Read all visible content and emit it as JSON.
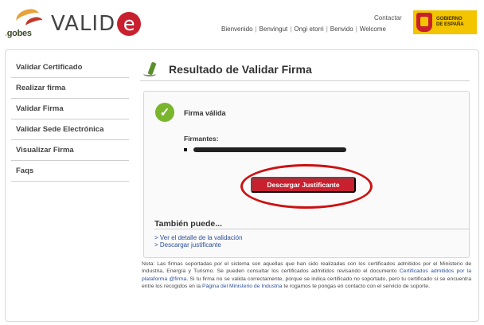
{
  "header": {
    "gob_logo_text": "gob",
    "gob_logo_suffix": "es",
    "app_logo_text": "VALID",
    "app_logo_letter": "e",
    "contact_label": "Contactar",
    "languages": [
      "Bienvenido",
      "Benvingut",
      "Ongi etorri",
      "Benvido",
      "Welcome"
    ],
    "gov_logo_text_1": "GOBIERNO",
    "gov_logo_text_2": "DE ESPAÑA"
  },
  "sidebar": {
    "items": [
      {
        "label": "Validar Certificado"
      },
      {
        "label": "Realizar firma"
      },
      {
        "label": "Validar Firma"
      },
      {
        "label": "Validar Sede Electrónica"
      },
      {
        "label": "Visualizar Firma"
      },
      {
        "label": "Faqs"
      }
    ]
  },
  "main": {
    "title": "Resultado de Validar Firma",
    "status_text": "Firma válida",
    "signers_label": "Firmantes:",
    "download_button": "Descargar Justificante",
    "also_heading": "También puede...",
    "links": [
      "> Ver el detalle de la validación",
      "> Descargar justificante"
    ]
  },
  "note": {
    "part1": "Nota: Las firmas soportadas por el sistema son aquellas que han sido realizadas con los certificados admitidos por el Ministerio de Industria, Energía y Turismo. Se pueden consultar los certificados admitidos revisando el documento ",
    "link1": "Certificados admitidos por la plataforma @firma",
    "part2": ". Si tu firma no se valida correctamente, porque se indica certificado no soportado, pero tu certificado si se encuentra entre los recogidos en la ",
    "link2": "Página del Ministerio de Industria",
    "part3": " te rogamos te pongas en contacto con el servicio de soporte."
  },
  "colors": {
    "brand_red": "#c8202e",
    "success_green": "#7ab52e",
    "link_blue": "#2a4f9a",
    "gov_yellow": "#f3c400",
    "highlight_oval": "#cc1111"
  },
  "icons": {
    "status": "check-circle-icon",
    "title": "signature-pen-icon",
    "signer_bullet": "square-bullet-icon"
  }
}
